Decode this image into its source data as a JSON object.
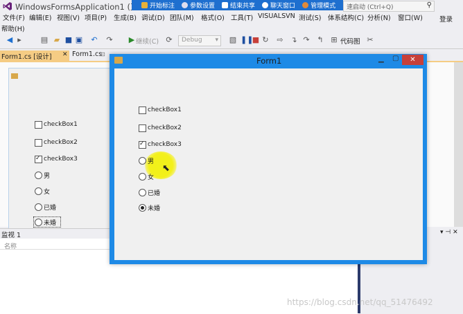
{
  "window": {
    "title": "WindowsFormsApplication1 (正在",
    "login": "登录"
  },
  "share_bar": {
    "items": [
      "开始标注",
      "参数设置",
      "结束共享",
      "聊天窗口",
      "管理模式"
    ]
  },
  "quick_launch": {
    "placeholder": "速启动 (Ctrl+Q)"
  },
  "menu": {
    "items": [
      "文件(F)",
      "编辑(E)",
      "视图(V)",
      "项目(P)",
      "生成(B)",
      "调试(D)",
      "团队(M)",
      "格式(O)",
      "工具(T)",
      "VISUALSVN",
      "测试(S)",
      "体系结构(C)",
      "分析(N)",
      "窗口(W)",
      "帮助(H)"
    ]
  },
  "toolbar": {
    "continue_label": "继续(C)",
    "config": "Debug",
    "codemap_label": "代码图"
  },
  "tabs": {
    "designer": "Form1.cs [设计]",
    "code": "Form1.cs"
  },
  "designer": {
    "checkboxes": [
      {
        "label": "checkBox1",
        "checked": false
      },
      {
        "label": "checkBox2",
        "checked": false
      },
      {
        "label": "checkBox3",
        "checked": true
      }
    ],
    "radios": [
      {
        "label": "男",
        "checked": false
      },
      {
        "label": "女",
        "checked": false
      },
      {
        "label": "已婚",
        "checked": false
      },
      {
        "label": "未婚",
        "checked": false
      }
    ]
  },
  "watch": {
    "title": "监视 1",
    "column": "名称"
  },
  "form1": {
    "title": "Form1",
    "checkboxes": [
      {
        "label": "checkBox1",
        "checked": false
      },
      {
        "label": "checkBox2",
        "checked": false
      },
      {
        "label": "checkBox3",
        "checked": true
      }
    ],
    "radios": [
      {
        "label": "男",
        "checked": false
      },
      {
        "label": "女",
        "checked": false
      },
      {
        "label": "已婚",
        "checked": false
      },
      {
        "label": "未婚",
        "checked": true
      }
    ]
  },
  "watermark": "https://blog.csdn.net/qq_51476492",
  "colors": {
    "share_bar": "#1e6fcf",
    "form_border": "#1e8ae6",
    "close_button": "#c7403a",
    "tab_active": "#f5cc84"
  }
}
